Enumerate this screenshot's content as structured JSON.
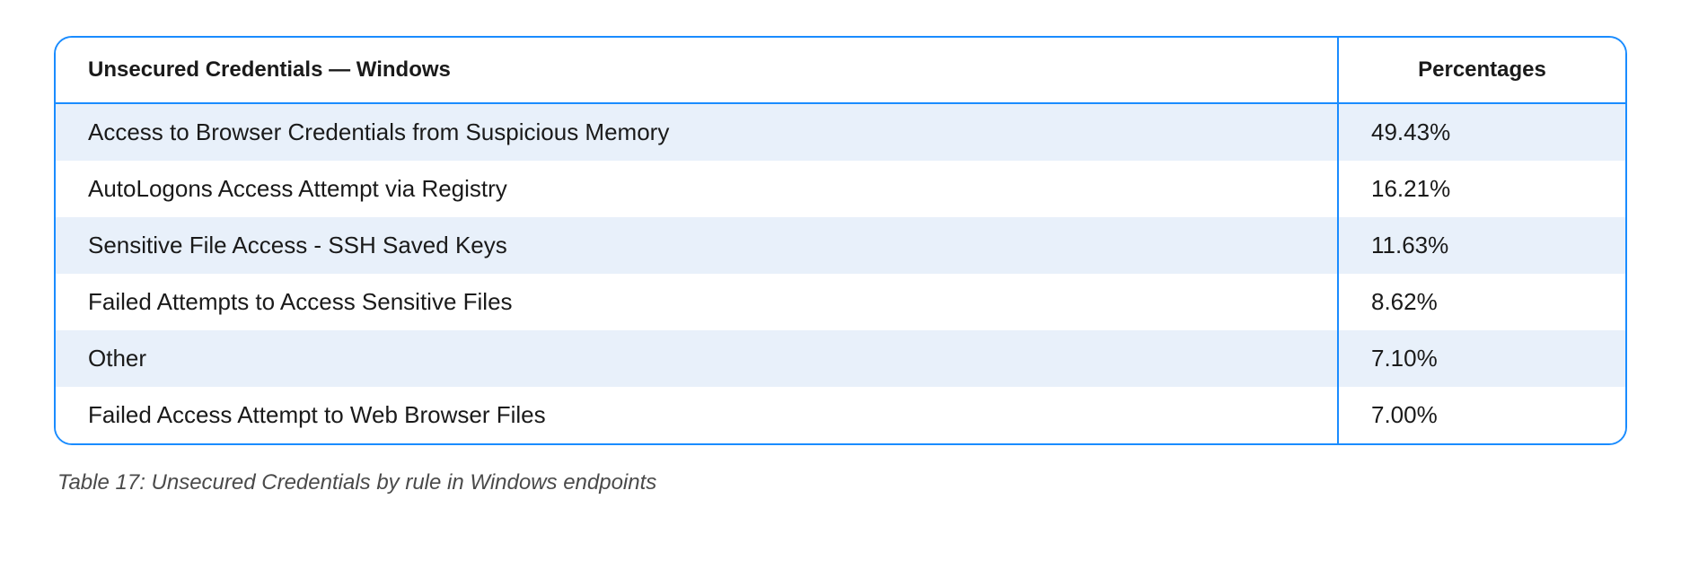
{
  "table": {
    "headers": {
      "col1": "Unsecured Credentials — Windows",
      "col2": "Percentages"
    },
    "rows": [
      {
        "label": "Access to Browser Credentials from Suspicious Memory",
        "value": "49.43%"
      },
      {
        "label": "AutoLogons Access Attempt via Registry",
        "value": "16.21%"
      },
      {
        "label": "Sensitive File Access - SSH Saved Keys",
        "value": "11.63%"
      },
      {
        "label": "Failed Attempts to Access Sensitive Files",
        "value": "8.62%"
      },
      {
        "label": "Other",
        "value": "7.10%"
      },
      {
        "label": "Failed Access Attempt to Web Browser Files",
        "value": "7.00%"
      }
    ]
  },
  "caption": "Table 17: Unsecured Credentials by rule in Windows endpoints",
  "chart_data": {
    "type": "table",
    "title": "Unsecured Credentials — Windows",
    "categories": [
      "Access to Browser Credentials from Suspicious Memory",
      "AutoLogons Access Attempt via Registry",
      "Sensitive File Access - SSH Saved Keys",
      "Failed Attempts to Access Sensitive Files",
      "Other",
      "Failed Access Attempt to Web Browser Files"
    ],
    "values": [
      49.43,
      16.21,
      11.63,
      8.62,
      7.1,
      7.0
    ],
    "ylabel": "Percentages"
  }
}
